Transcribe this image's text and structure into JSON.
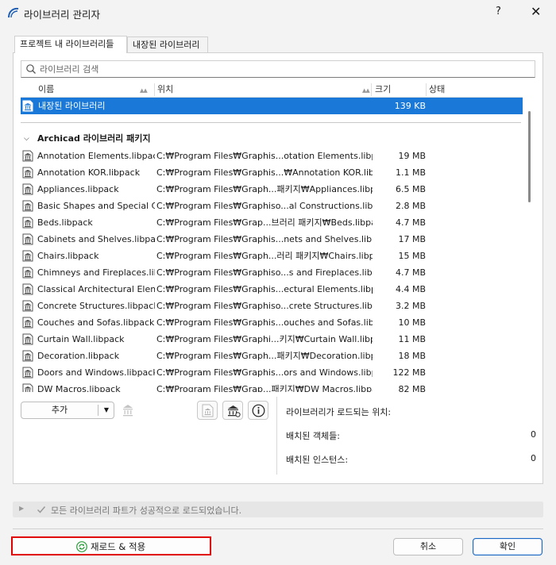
{
  "window": {
    "title": "라이브러리 관리자",
    "help_label": "?",
    "close_label": "✕"
  },
  "tabs": [
    {
      "label": "프로젝트 내 라이브러리들",
      "active": true
    },
    {
      "label": "내장된 라이브러리",
      "active": false
    }
  ],
  "search": {
    "placeholder": "라이브러리 검색",
    "icon": "search-icon"
  },
  "columns": {
    "name": "이름",
    "location": "위치",
    "size": "크기",
    "status": "상태"
  },
  "embedded_row": {
    "name": "내장된 라이브러리",
    "size": "139 KB",
    "selected": true
  },
  "group": {
    "label": "Archicad 라이브러리 패키지",
    "expanded": true
  },
  "packages": [
    {
      "name": "Annotation Elements.libpack",
      "location": "C:₩Program Files₩Graphis...otation Elements.libpack",
      "size": "19 MB"
    },
    {
      "name": "Annotation KOR.libpack",
      "location": "C:₩Program Files₩Graphis...₩Annotation KOR.libpack",
      "size": "1.1 MB"
    },
    {
      "name": "Appliances.libpack",
      "location": "C:₩Program Files₩Graph...패키지₩Appliances.libpack",
      "size": "6.5 MB"
    },
    {
      "name": "Basic Shapes and Special C...",
      "location": "C:₩Program Files₩Graphiso...al Constructions.libpack",
      "size": "2.8 MB"
    },
    {
      "name": "Beds.libpack",
      "location": "C:₩Program Files₩Grap...브러리 패키지₩Beds.libpack",
      "size": "4.7 MB"
    },
    {
      "name": "Cabinets and Shelves.libpa...",
      "location": "C:₩Program Files₩Graphis...nets and Shelves.libpack",
      "size": "17 MB"
    },
    {
      "name": "Chairs.libpack",
      "location": "C:₩Program Files₩Graph...러리 패키지₩Chairs.libpack",
      "size": "15 MB"
    },
    {
      "name": "Chimneys and Fireplaces.lib...",
      "location": "C:₩Program Files₩Graphiso...s and Fireplaces.libpack",
      "size": "4.7 MB"
    },
    {
      "name": "Classical Architectural Elem...",
      "location": "C:₩Program Files₩Graphis...ectural Elements.libpack",
      "size": "4.4 MB"
    },
    {
      "name": "Concrete Structures.libpack",
      "location": "C:₩Program Files₩Graphiso...crete Structures.libpack",
      "size": "3.2 MB"
    },
    {
      "name": "Couches and Sofas.libpack",
      "location": "C:₩Program Files₩Graphis...ouches and Sofas.libpack",
      "size": "10 MB"
    },
    {
      "name": "Curtain Wall.libpack",
      "location": "C:₩Program Files₩Graphi...키지₩Curtain Wall.libpack",
      "size": "11 MB"
    },
    {
      "name": "Decoration.libpack",
      "location": "C:₩Program Files₩Graph...패키지₩Decoration.libpack",
      "size": "18 MB"
    },
    {
      "name": "Doors and Windows.libpack",
      "location": "C:₩Program Files₩Graphis...ors and Windows.libpack",
      "size": "122 MB"
    },
    {
      "name": "DW Macros.libpack",
      "location": "C:₩Program Files₩Grap...패키지₩DW Macros.libpack",
      "size": "82 MB"
    }
  ],
  "toolbar": {
    "add_label": "추가",
    "dropdown_icon": "caret-down-icon"
  },
  "info": {
    "load_location_label": "라이브러리가 로드되는 위치:",
    "placed_objects_label": "배치된 객체들:",
    "placed_objects_value": "0",
    "placed_instances_label": "배치된 인스턴스:",
    "placed_instances_value": "0"
  },
  "status": {
    "message": "모든 라이브러리 파트가 성공적으로 로드되었습니다."
  },
  "footer": {
    "reload_label": "재로드 & 적용",
    "cancel_label": "취소",
    "ok_label": "확인"
  },
  "colors": {
    "selection": "#1a79d8",
    "highlight_border": "#e00000",
    "primary_border": "#1a67c2",
    "refresh_icon": "#2e9e3e"
  }
}
